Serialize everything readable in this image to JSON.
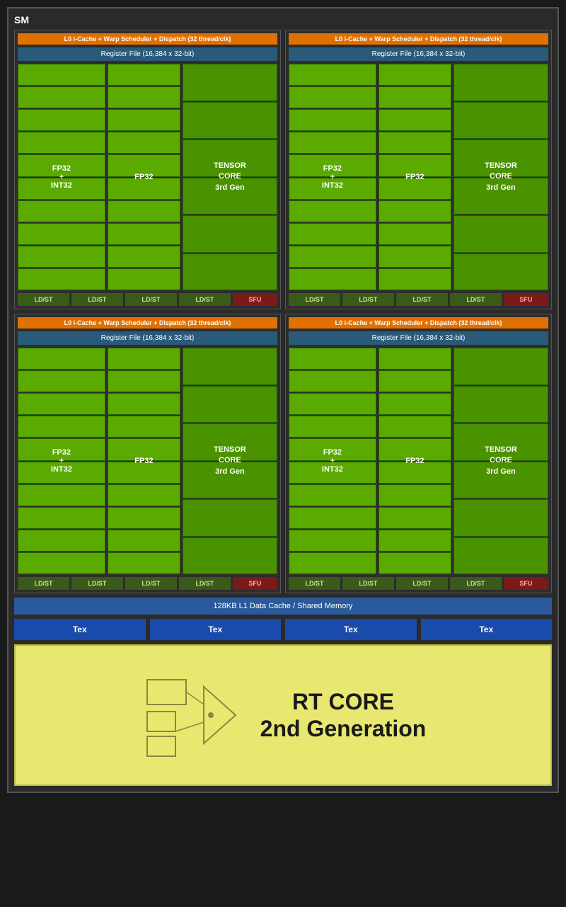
{
  "sm": {
    "label": "SM",
    "quadrants": [
      {
        "id": "q1",
        "warp_scheduler": "L0 i-Cache + Warp Scheduler + Dispatch (32 thread/clk)",
        "register_file": "Register File (16,384 x 32-bit)",
        "fp32_int32_label": "FP32\n+\nINT32",
        "fp32_label": "FP32",
        "tensor_label": "TENSOR\nCORE\n3rd Gen",
        "ldst_units": [
          "LD/ST",
          "LD/ST",
          "LD/ST",
          "LD/ST"
        ],
        "sfu_label": "SFU"
      },
      {
        "id": "q2",
        "warp_scheduler": "L0 i-Cache + Warp Scheduler + Dispatch (32 thread/clk)",
        "register_file": "Register File (16,384 x 32-bit)",
        "fp32_int32_label": "FP32\n+\nINT32",
        "fp32_label": "FP32",
        "tensor_label": "TENSOR\nCORE\n3rd Gen",
        "ldst_units": [
          "LD/ST",
          "LD/ST",
          "LD/ST",
          "LD/ST"
        ],
        "sfu_label": "SFU"
      },
      {
        "id": "q3",
        "warp_scheduler": "L0 i-Cache + Warp Scheduler + Dispatch (32 thread/clk)",
        "register_file": "Register File (16,384 x 32-bit)",
        "fp32_int32_label": "FP32\n+\nINT32",
        "fp32_label": "FP32",
        "tensor_label": "TENSOR\nCORE\n3rd Gen",
        "ldst_units": [
          "LD/ST",
          "LD/ST",
          "LD/ST",
          "LD/ST"
        ],
        "sfu_label": "SFU"
      },
      {
        "id": "q4",
        "warp_scheduler": "L0 i-Cache + Warp Scheduler + Dispatch (32 thread/clk)",
        "register_file": "Register File (16,384 x 32-bit)",
        "fp32_int32_label": "FP32\n+\nINT32",
        "fp32_label": "FP32",
        "tensor_label": "TENSOR\nCORE\n3rd Gen",
        "ldst_units": [
          "LD/ST",
          "LD/ST",
          "LD/ST",
          "LD/ST"
        ],
        "sfu_label": "SFU"
      }
    ],
    "l1_cache": "128KB L1 Data Cache / Shared Memory",
    "tex_units": [
      "Tex",
      "Tex",
      "Tex",
      "Tex"
    ],
    "rt_core": {
      "line1": "RT CORE",
      "line2": "2nd Generation"
    }
  }
}
